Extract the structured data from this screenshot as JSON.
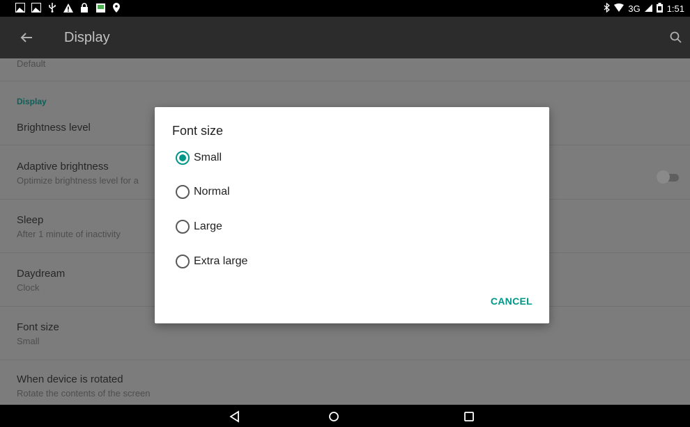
{
  "status_bar": {
    "left_icons": [
      "image-notification-icon",
      "image-notification-icon",
      "usb-icon",
      "warning-icon",
      "lock-icon",
      "app-notification-icon",
      "location-icon"
    ],
    "network": "3G",
    "time": "1:51"
  },
  "app_bar": {
    "title": "Display"
  },
  "settings": {
    "top_partial_summary": "Default",
    "category": "Display",
    "items": [
      {
        "title": "Brightness level",
        "summary": ""
      },
      {
        "title": "Adaptive brightness",
        "summary": "Optimize brightness level for a",
        "toggle_on": false
      },
      {
        "title": "Sleep",
        "summary": "After 1 minute of inactivity"
      },
      {
        "title": "Daydream",
        "summary": "Clock"
      },
      {
        "title": "Font size",
        "summary": "Small"
      },
      {
        "title": "When device is rotated",
        "summary": "Rotate the contents of the screen"
      }
    ]
  },
  "dialog": {
    "title": "Font size",
    "options": [
      {
        "label": "Small",
        "selected": true
      },
      {
        "label": "Normal",
        "selected": false
      },
      {
        "label": "Large",
        "selected": false
      },
      {
        "label": "Extra large",
        "selected": false
      }
    ],
    "cancel_label": "CANCEL"
  },
  "nav_bar": {
    "buttons": [
      "back-icon",
      "home-icon",
      "recents-icon"
    ]
  },
  "colors": {
    "accent": "#009688",
    "category": "#0f5e58",
    "app_bar": "#2c2c2c",
    "dim_background": "#7c7c7c"
  }
}
